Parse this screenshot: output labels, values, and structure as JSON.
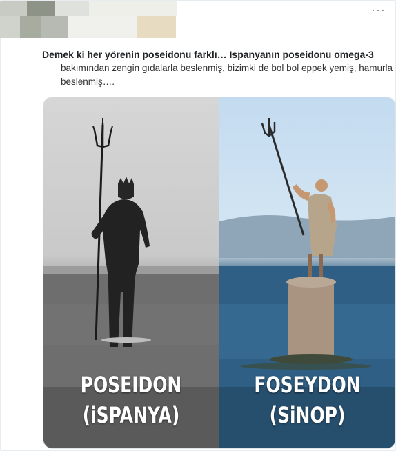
{
  "tweet": {
    "more_icon": "more-horizontal-icon",
    "more_label": "···",
    "text_bold": "Demek ki her yörenin poseidonu farklı… Ispanyanın poseidonu omega-3",
    "text_rest": "bakımından zengin gıdalarla beslenmiş, bizimki de bol bol eppek yemiş, hamurla beslenmiş…."
  },
  "image": {
    "left": {
      "name": "POSEIDON",
      "country": "(iSPANYA)"
    },
    "right": {
      "name": "FOSEYDON",
      "country": "(SiNOP)"
    }
  },
  "colors": {
    "border": "#e6ecf0",
    "text": "#0f1419",
    "sea_blue": "#2a5779"
  }
}
